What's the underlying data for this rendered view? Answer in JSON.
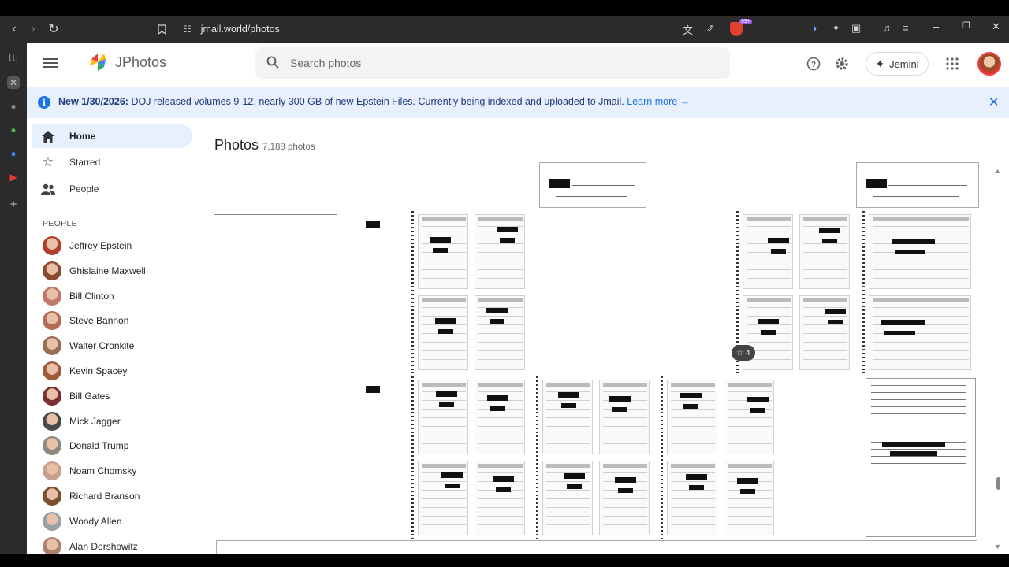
{
  "browser": {
    "url": "jmail.world/photos"
  },
  "header": {
    "brand": "JPhotos",
    "search_placeholder": "Search photos",
    "jemini_label": "Jemini"
  },
  "banner": {
    "bold": "New 1/30/2026:",
    "text": "DOJ released volumes 9-12, nearly 300 GB of new Epstein Files. Currently being indexed and uploaded to Jmail.",
    "link": "Learn more →"
  },
  "sidebar": {
    "nav": [
      {
        "label": "Home",
        "icon": "home-icon",
        "active": true
      },
      {
        "label": "Starred",
        "icon": "star-icon",
        "active": false
      },
      {
        "label": "People",
        "icon": "people-icon",
        "active": false
      }
    ],
    "people_header": "PEOPLE",
    "people": [
      {
        "name": "Jeffrey Epstein",
        "color": "#b0402c"
      },
      {
        "name": "Ghislaine Maxwell",
        "color": "#8a4a30"
      },
      {
        "name": "Bill Clinton",
        "color": "#c07a6a"
      },
      {
        "name": "Steve Bannon",
        "color": "#b26b55"
      },
      {
        "name": "Walter Cronkite",
        "color": "#9a6b55"
      },
      {
        "name": "Kevin Spacey",
        "color": "#a05a3a"
      },
      {
        "name": "Bill Gates",
        "color": "#7a3030"
      },
      {
        "name": "Mick Jagger",
        "color": "#4a4a4a"
      },
      {
        "name": "Donald Trump",
        "color": "#8a8a80"
      },
      {
        "name": "Noam Chomsky",
        "color": "#c8a090"
      },
      {
        "name": "Richard Branson",
        "color": "#7a5030"
      },
      {
        "name": "Woody Allen",
        "color": "#9aa0a8"
      },
      {
        "name": "Alan Dershowitz",
        "color": "#b08070"
      }
    ]
  },
  "main": {
    "title": "Photos",
    "count": "7,188 photos",
    "badge_count": "4"
  },
  "colors": {
    "accent": "#1a73e8",
    "banner_bg": "#e8f0fe"
  }
}
